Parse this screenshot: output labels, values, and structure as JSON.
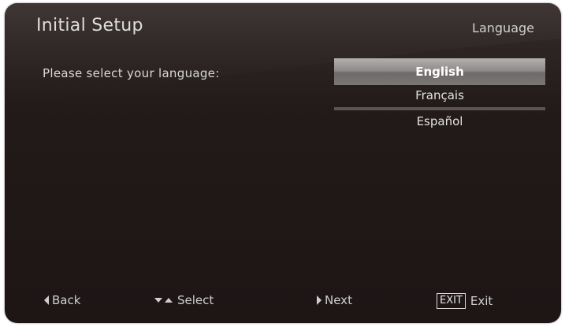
{
  "header": {
    "title": "Initial Setup",
    "section": "Language"
  },
  "prompt": "Please select your language:",
  "languages": {
    "items": [
      "English",
      "Français",
      "Español"
    ],
    "selected": "English"
  },
  "footer": {
    "back_label": "Back",
    "select_label": "Select",
    "next_label": "Next",
    "exit_key_label": "EXIT",
    "exit_label": "Exit"
  }
}
